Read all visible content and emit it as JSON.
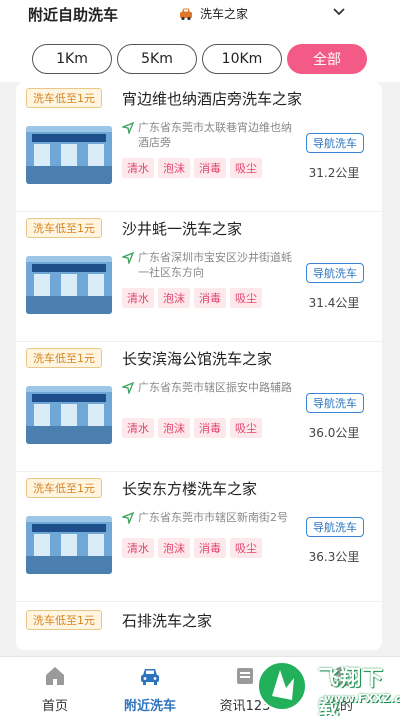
{
  "header": {
    "title": "附近自助洗车",
    "selected_store": "洗车之家"
  },
  "filters": [
    "1Km",
    "5Km",
    "10Km",
    "全部"
  ],
  "active_filter": "全部",
  "stations": [
    {
      "promo": "洗车低至1元",
      "name": "宵边维也纳酒店旁洗车之家",
      "address": "广东省东莞市太联巷宵边维也纳酒店旁",
      "tags": [
        "清水",
        "泡沫",
        "消毒",
        "吸尘"
      ],
      "nav_label": "导航洗车",
      "distance": "31.2公里"
    },
    {
      "promo": "洗车低至1元",
      "name": "沙井蚝一洗车之家",
      "address": "广东省深圳市宝安区沙井街道蚝一社区东方向",
      "tags": [
        "清水",
        "泡沫",
        "消毒",
        "吸尘"
      ],
      "nav_label": "导航洗车",
      "distance": "31.4公里"
    },
    {
      "promo": "洗车低至1元",
      "name": "长安滨海公馆洗车之家",
      "address": "广东省东莞市辖区振安中路辅路",
      "tags": [
        "清水",
        "泡沫",
        "消毒",
        "吸尘"
      ],
      "nav_label": "导航洗车",
      "distance": "36.0公里"
    },
    {
      "promo": "洗车低至1元",
      "name": "长安东方楼洗车之家",
      "address": "广东省东莞市市辖区新南街2号",
      "tags": [
        "清水",
        "泡沫",
        "消毒",
        "吸尘"
      ],
      "nav_label": "导航洗车",
      "distance": "36.3公里"
    },
    {
      "promo": "洗车低至1元",
      "name": "石排洗车之家"
    }
  ],
  "tabbar": [
    {
      "label": "首页",
      "icon": "home-icon"
    },
    {
      "label": "附近洗车",
      "icon": "car-icon"
    },
    {
      "label": "资讯123",
      "icon": "news-icon"
    },
    {
      "label": "我的",
      "icon": "user-icon"
    }
  ],
  "watermark": {
    "main": "飞翔下载",
    "sub": "www.FXXZ.com"
  },
  "colors": {
    "accent": "#f35a85",
    "nav_blue": "#2d73bd",
    "promo": "#d58322",
    "tag": "#e4436c"
  }
}
